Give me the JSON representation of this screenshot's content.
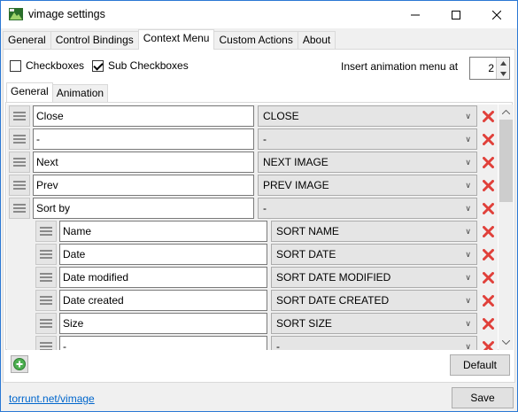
{
  "window": {
    "title": "vimage settings"
  },
  "tabs": [
    {
      "label": "General"
    },
    {
      "label": "Control Bindings"
    },
    {
      "label": "Context Menu"
    },
    {
      "label": "Custom Actions"
    },
    {
      "label": "About"
    }
  ],
  "active_tab": "Context Menu",
  "options": {
    "checkboxes_label": "Checkboxes",
    "checkboxes_checked": false,
    "sub_checkboxes_label": "Sub Checkboxes",
    "sub_checkboxes_checked": true,
    "insert_anim_label": "Insert animation menu at",
    "insert_anim_value": "2"
  },
  "subtabs": [
    {
      "label": "General"
    },
    {
      "label": "Animation"
    }
  ],
  "menu_items": [
    {
      "name": "Close",
      "action": "CLOSE",
      "level": 0
    },
    {
      "name": "-",
      "action": "-",
      "level": 0
    },
    {
      "name": "Next",
      "action": "NEXT IMAGE",
      "level": 0
    },
    {
      "name": "Prev",
      "action": "PREV IMAGE",
      "level": 0
    },
    {
      "name": "Sort by",
      "action": "-",
      "level": 0
    },
    {
      "name": "Name",
      "action": "SORT NAME",
      "level": 1
    },
    {
      "name": "Date",
      "action": "SORT DATE",
      "level": 1
    },
    {
      "name": "Date modified",
      "action": "SORT DATE MODIFIED",
      "level": 1
    },
    {
      "name": "Date created",
      "action": "SORT DATE CREATED",
      "level": 1
    },
    {
      "name": "Size",
      "action": "SORT SIZE",
      "level": 1
    },
    {
      "name": "-",
      "action": "-",
      "level": 1
    }
  ],
  "buttons": {
    "default_label": "Default",
    "save_label": "Save"
  },
  "footer": {
    "link_text": "torrunt.net/vimage"
  },
  "colors": {
    "delete_red": "#e0403a",
    "add_green": "#4caf50",
    "link_blue": "#0066cc"
  }
}
